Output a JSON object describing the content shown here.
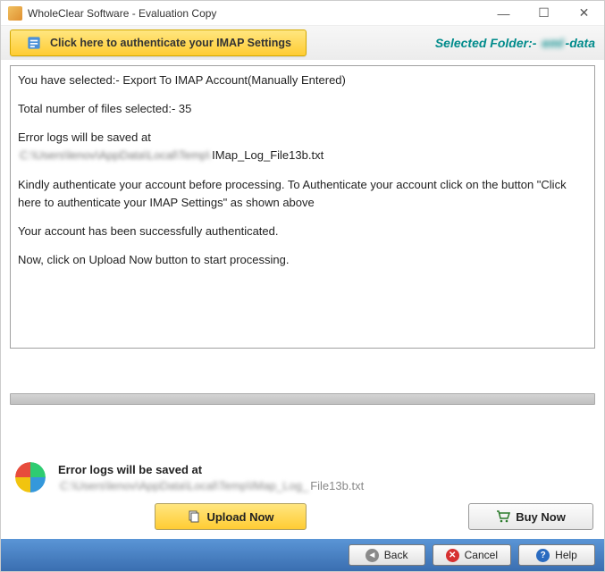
{
  "titlebar": {
    "text": "WholeClear Software - Evaluation Copy"
  },
  "toolbar": {
    "auth_label": "Click here to authenticate your IMAP Settings",
    "selected_folder_label": "Selected Folder:-",
    "selected_folder_prefix": "eml",
    "selected_folder_value": "-data"
  },
  "log": {
    "line1": "You have selected:- Export To IMAP Account(Manually Entered)",
    "line2": "Total number of files selected:- 35",
    "line3_a": "Error logs will be saved at",
    "line3_path_blur": "C:\\Users\\lenov\\AppData\\Local\\Temp\\",
    "line3_path_clear": "IMap_Log_File13b.txt",
    "line4": "Kindly authenticate your account before processing. To Authenticate your account click on the button \"Click here to authenticate your IMAP Settings\" as shown above",
    "line5": "Your account has been successfully authenticated.",
    "line6": "Now, click on Upload Now button to start processing."
  },
  "bottom": {
    "title": "Error logs will be saved at",
    "path_blur": "C:\\Users\\lenov\\AppData\\Local\\Temp\\IMap_Log_",
    "path_clear": "File13b.txt"
  },
  "actions": {
    "upload": "Upload Now",
    "buy": "Buy Now"
  },
  "footer": {
    "back": "Back",
    "cancel": "Cancel",
    "help": "Help"
  }
}
